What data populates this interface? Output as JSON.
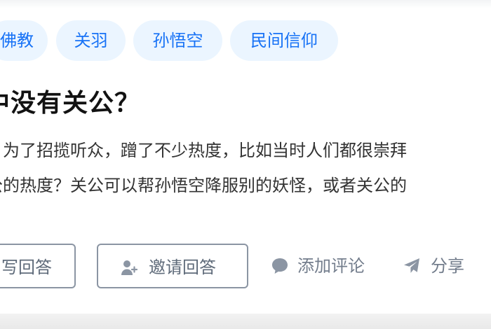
{
  "tags": [
    "佛教",
    "关羽",
    "孙悟空",
    "民间信仰"
  ],
  "question": {
    "title": "中没有关公？",
    "excerpt_lines": [
      "，为了招揽听众，蹭了不少热度，比如当时人们都很崇拜",
      "公的热度？关公可以帮孙悟空降服别的妖怪，或者关公的"
    ]
  },
  "actions": {
    "write_answer": "写回答",
    "invite_answer": "邀请回答",
    "add_comment": "添加评论",
    "share": "分享"
  },
  "colors": {
    "tag_background": "#ebf5ff",
    "tag_text": "#1772f6",
    "title": "#121212",
    "secondary": "#737d8c"
  },
  "icons": {
    "invite": "invite-user-icon",
    "comment": "comment-bubble-icon",
    "share": "share-plane-icon"
  }
}
